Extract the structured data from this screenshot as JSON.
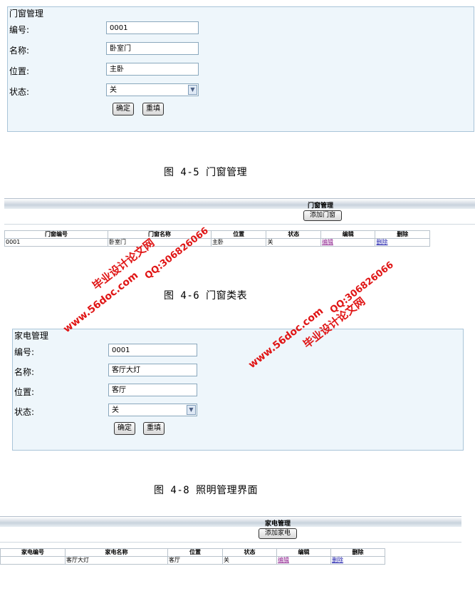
{
  "door_form": {
    "title": "门窗管理",
    "fields": [
      {
        "label": "编号:",
        "value": "0001"
      },
      {
        "label": "名称:",
        "value": "卧室门"
      },
      {
        "label": "位置:",
        "value": "主卧"
      },
      {
        "label": "状态:",
        "value": "关"
      }
    ],
    "confirm_label": "确定",
    "reset_label": "重填"
  },
  "caption_1": "图 4-5 门窗管理",
  "door_table": {
    "title": "门窗管理",
    "add_button": "添加门窗",
    "headers": [
      "门窗编号",
      "门窗名称",
      "位置",
      "状态",
      "编辑",
      "删除"
    ],
    "row": [
      "0001",
      "卧室门",
      "主卧",
      "关",
      "编辑",
      "删除"
    ]
  },
  "caption_2": "图 4-6 门窗类表",
  "appliance_form": {
    "title": "家电管理",
    "fields": [
      {
        "label": "编号:",
        "value": "0001"
      },
      {
        "label": "名称:",
        "value": "客厅大灯"
      },
      {
        "label": "位置:",
        "value": "客厅"
      },
      {
        "label": "状态:",
        "value": "关"
      }
    ],
    "confirm_label": "确定",
    "reset_label": "重填"
  },
  "caption_3": "图 4-8 照明管理界面",
  "appliance_table": {
    "title": "家电管理",
    "add_button": "添加家电",
    "headers": [
      "家电编号",
      "家电名称",
      "位置",
      "状态",
      "编辑",
      "删除"
    ],
    "row": [
      "",
      "客厅大灯",
      "客厅",
      "关",
      "编辑",
      "删除"
    ]
  },
  "watermark": {
    "site": "www.56doc.com",
    "qq": "QQ:306826066",
    "name": "毕业设计论文网",
    "color": "#e01515"
  }
}
